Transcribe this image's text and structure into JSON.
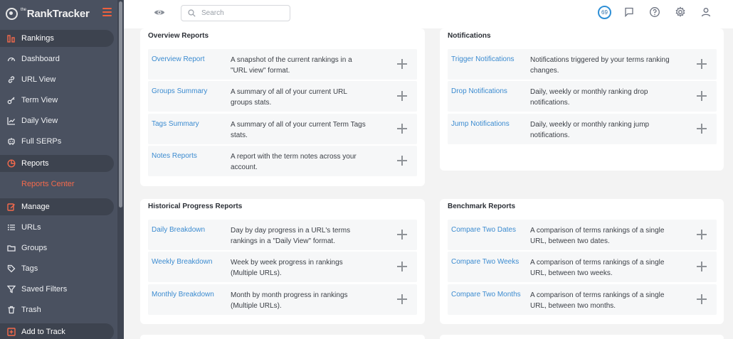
{
  "sidebar": {
    "brand": "RankTracker",
    "brand_prefix": "the",
    "items": [
      {
        "label": "Rankings",
        "icon": "bar-chart-icon",
        "section": true
      },
      {
        "label": "Dashboard",
        "icon": "gauge-icon"
      },
      {
        "label": "URL View",
        "icon": "link-icon"
      },
      {
        "label": "Term View",
        "icon": "key-icon"
      },
      {
        "label": "Daily View",
        "icon": "line-chart-icon"
      },
      {
        "label": "Full SERPs",
        "icon": "robot-icon"
      },
      {
        "label": "Reports",
        "icon": "pie-chart-icon",
        "section": true
      },
      {
        "label": "Reports Center",
        "icon": "",
        "active": true
      },
      {
        "label": "Manage",
        "icon": "edit-icon",
        "section": true
      },
      {
        "label": "URLs",
        "icon": "list-icon"
      },
      {
        "label": "Groups",
        "icon": "folder-icon"
      },
      {
        "label": "Tags",
        "icon": "tag-icon"
      },
      {
        "label": "Saved Filters",
        "icon": "filter-icon"
      },
      {
        "label": "Trash",
        "icon": "trash-icon"
      },
      {
        "label": "Add to Track",
        "icon": "plus-square-icon",
        "section": true
      }
    ]
  },
  "topbar": {
    "search_placeholder": "Search",
    "credits": "69"
  },
  "cards": {
    "overview": {
      "title": "Overview Reports",
      "rows": [
        {
          "link": "Overview Report",
          "desc": "A snapshot of the current rankings in a \"URL view\" format."
        },
        {
          "link": "Groups Summary",
          "desc": "A summary of all of your current URL groups stats."
        },
        {
          "link": "Tags Summary",
          "desc": "A summary of all of your current Term Tags stats."
        },
        {
          "link": "Notes Reports",
          "desc": "A report with the term notes across your account."
        }
      ]
    },
    "notifications": {
      "title": "Notifications",
      "rows": [
        {
          "link": "Trigger Notifications",
          "desc": "Notifications triggered by your terms ranking changes."
        },
        {
          "link": "Drop Notifications",
          "desc": "Daily, weekly or monthly ranking drop notifications."
        },
        {
          "link": "Jump Notifications",
          "desc": "Daily, weekly or monthly ranking jump notifications."
        }
      ]
    },
    "historical": {
      "title": "Historical Progress Reports",
      "rows": [
        {
          "link": "Daily Breakdown",
          "desc": "Day by day progress in a URL's terms rankings in a \"Daily View\" format."
        },
        {
          "link": "Weekly Breakdown",
          "desc": "Week by week progress in rankings (Multiple URLs)."
        },
        {
          "link": "Monthly Breakdown",
          "desc": "Month by month progress in rankings (Multiple URLs)."
        }
      ]
    },
    "benchmark": {
      "title": "Benchmark Reports",
      "rows": [
        {
          "link": "Compare Two Dates",
          "desc": "A comparison of terms rankings of a single URL, between two dates."
        },
        {
          "link": "Compare Two Weeks",
          "desc": "A comparison of terms rankings of a single URL, between two weeks."
        },
        {
          "link": "Compare Two Months",
          "desc": "A comparison of terms rankings of a single URL, between two months."
        }
      ]
    }
  }
}
